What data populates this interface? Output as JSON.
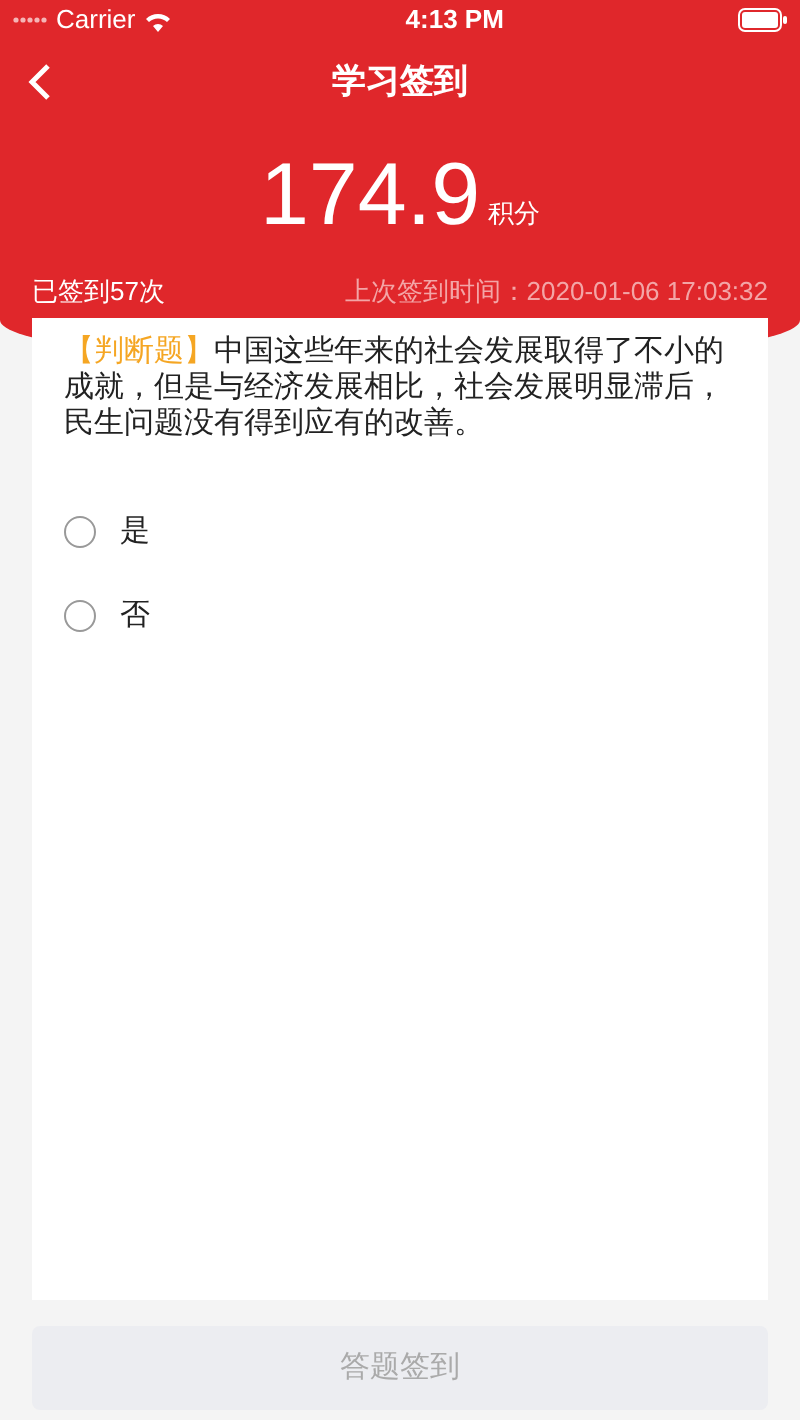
{
  "status_bar": {
    "carrier": "Carrier",
    "time": "4:13 PM"
  },
  "nav": {
    "title": "学习签到"
  },
  "score": {
    "value": "174.9",
    "unit": "积分"
  },
  "signed_count": "已签到57次",
  "last_sign": "上次签到时间：2020-01-06 17:03:32",
  "question": {
    "tag": "【判断题】",
    "text": "中国这些年来的社会发展取得了不小的成就，但是与经济发展相比，社会发展明显滞后，民生问题没有得到应有的改善。"
  },
  "options": [
    {
      "label": "是",
      "selected": false
    },
    {
      "label": "否",
      "selected": false
    }
  ],
  "submit": {
    "label": "答题签到",
    "disabled": true
  }
}
